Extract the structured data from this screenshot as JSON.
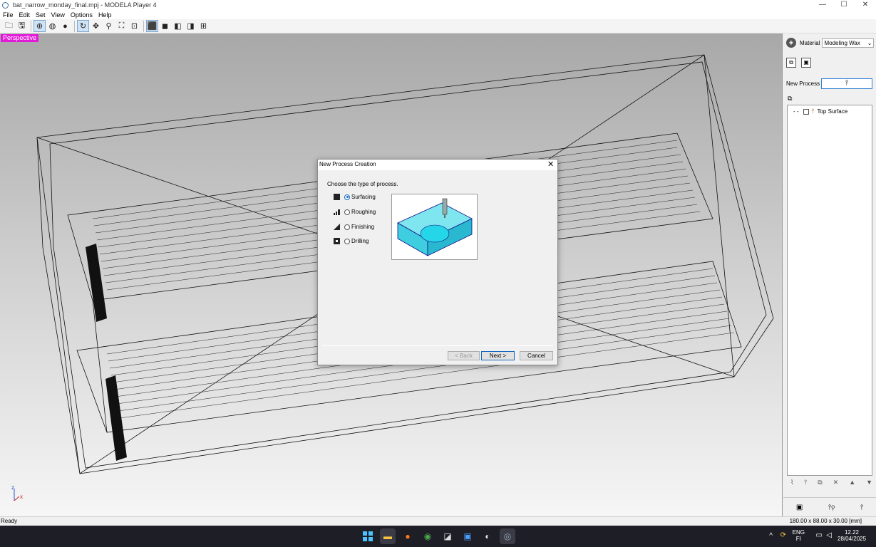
{
  "window": {
    "title": "bat_narrow_monday_final.mpj - MODELA Player 4",
    "controls": [
      "—",
      "☐",
      "✕"
    ]
  },
  "menu": [
    "File",
    "Edit",
    "Set",
    "View",
    "Options",
    "Help"
  ],
  "viewport": {
    "label": "Perspective",
    "axis_z": "z",
    "axis_x": "x"
  },
  "panel": {
    "material_label": "Material",
    "material_value": "Modeling Wax",
    "new_process_label": "New Process",
    "tree_item": "Top Surface"
  },
  "dialog": {
    "title": "New Process Creation",
    "prompt": "Choose the type of process.",
    "options": [
      "Surfacing",
      "Roughing",
      "Finishing",
      "Drilling"
    ],
    "selected": "Surfacing",
    "back": "< Back",
    "next": "Next >",
    "cancel": "Cancel"
  },
  "status": {
    "text": "Ready",
    "dimensions": "180.00 x 88.00 x 30.00 [mm]"
  },
  "tray": {
    "lang": "ENG",
    "region": "FI",
    "time": "12.22",
    "date": "28/04/2025"
  }
}
